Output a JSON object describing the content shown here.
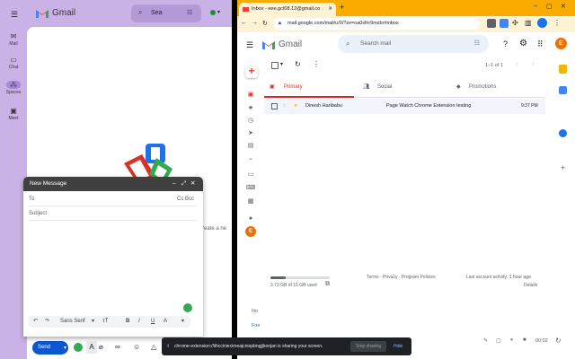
{
  "left": {
    "app_name": "Gmail",
    "search_text": "Sea",
    "rail": [
      {
        "label": "Mail",
        "icon": "mail-icon"
      },
      {
        "label": "Chat",
        "icon": "chat-icon"
      },
      {
        "label": "Spaces",
        "icon": "spaces-icon"
      },
      {
        "label": "Meet",
        "icon": "meet-icon"
      }
    ],
    "partial_text": "create a ne"
  },
  "compose": {
    "title": "New Message",
    "to_label": "To",
    "cc_bcc": "Cc Bcc",
    "subject_placeholder": "Subject",
    "font_name": "Sans Serif",
    "send_label": "Send"
  },
  "browser": {
    "tab_title": "Inbox - eee.gct08.12@gmail.co",
    "url": "mail.google.com/mail/u/0/?zx=oa0xlhr9mzbr#inbox",
    "accent": "#f9ab00"
  },
  "gmail": {
    "app_name": "Gmail",
    "search_placeholder": "Search mail",
    "avatar_letter": "E",
    "pagination": "1–1 of 1",
    "tabs": [
      {
        "label": "Primary",
        "active": true
      },
      {
        "label": "Social",
        "active": false
      },
      {
        "label": "Promotions",
        "active": false
      }
    ],
    "mail": [
      {
        "sender": "Dinesh Haribabu",
        "subject": "Page Watch Chrome Extension testing",
        "time": "9:37 PM"
      }
    ],
    "storage_used": "3.73 GB of 15 GB used",
    "storage_fraction": 0.25,
    "footer_links": "Terms · Privacy · Program Policies",
    "last_activity": "Last account activity: 1 hour ago",
    "details": "Details",
    "partial_left_1": "No",
    "partial_left_2": "Fire"
  },
  "sharebar": {
    "message": "chrome-extension://iihcciniecimeajcniapbngjjbonjan is sharing your screen.",
    "stop_label": "Stop sharing",
    "hide_label": "Hide"
  },
  "recorder": {
    "time": "00:02"
  }
}
